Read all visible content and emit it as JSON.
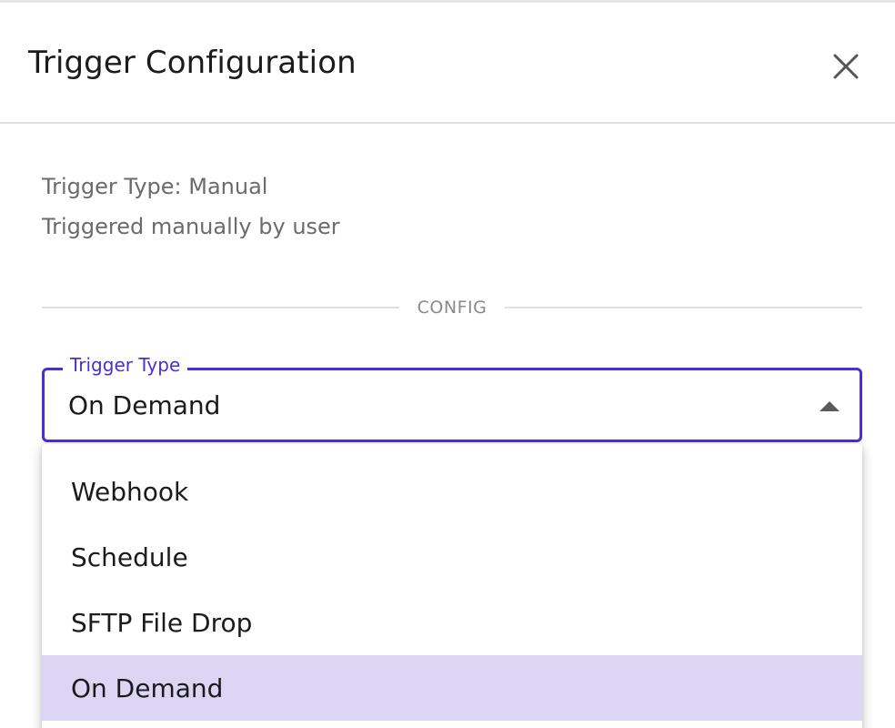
{
  "dialog": {
    "title": "Trigger Configuration"
  },
  "info": {
    "trigger_type_line": "Trigger Type: Manual",
    "description_line": "Triggered manually by user"
  },
  "section": {
    "divider_label": "CONFIG"
  },
  "trigger_select": {
    "label": "Trigger Type",
    "value": "On Demand",
    "options": [
      {
        "label": "Webhook",
        "selected": false
      },
      {
        "label": "Schedule",
        "selected": false
      },
      {
        "label": "SFTP File Drop",
        "selected": false
      },
      {
        "label": "On Demand",
        "selected": true
      }
    ]
  },
  "icons": {
    "close": "close-icon",
    "caret": "caret-up-icon"
  },
  "colors": {
    "accent": "#4a2fd1",
    "selected_bg": "#dcd6f4"
  }
}
